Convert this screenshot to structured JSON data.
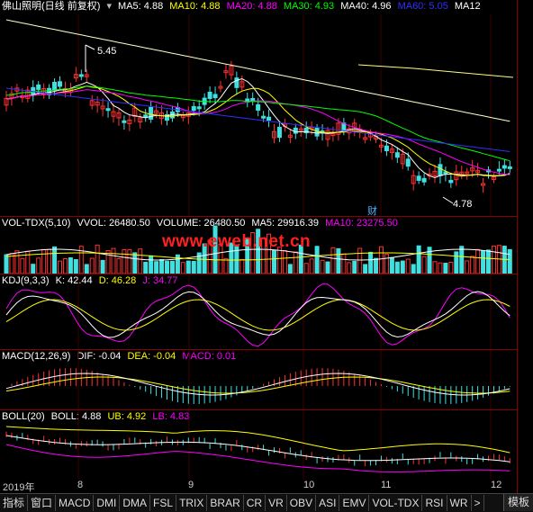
{
  "colors": {
    "ma5": "#ffffff",
    "ma10": "#ffff00",
    "ma20": "#ff00ff",
    "ma30": "#00ff00",
    "ma40": "#ffffff",
    "ma60": "#3030ff",
    "up": "#ff3030",
    "down": "#40e0e0",
    "watermark": "#ff2020"
  },
  "main": {
    "title": "佛山照明(日线 前复权)",
    "ma5": "MA5: 4.88",
    "ma10": "MA10: 4.88",
    "ma20": "MA20: 4.88",
    "ma30": "MA30: 4.93",
    "ma40": "MA40: 4.96",
    "ma60": "MA60: 5.05",
    "ma120": "MA12",
    "high_label": "5.45",
    "low_label": "4.78",
    "cai_label": "财"
  },
  "volume": {
    "name": "VOL-TDX(5,10)",
    "vvol": "VVOL: 26480.50",
    "volume": "VOLUME: 26480.50",
    "ma5": "MA5: 29916.39",
    "ma10": "MA10: 23275.50"
  },
  "watermark": "www.eweb.net.cn",
  "kdj": {
    "name": "KDJ(9,3,3)",
    "k": "K: 42.44",
    "d": "D: 46.28",
    "j": "J: 34.77"
  },
  "macd": {
    "name": "MACD(12,26,9)",
    "dif": "DIF: -0.04",
    "dea": "DEA: -0.04",
    "macd": "MACD: 0.01"
  },
  "boll": {
    "name": "BOLL(20)",
    "boll": "BOLL: 4.88",
    "ub": "UB: 4.92",
    "lb": "LB: 4.83"
  },
  "x_axis": {
    "year": "2019年",
    "m8": "8",
    "m9": "9",
    "m10": "10",
    "m11": "11",
    "m12": "12"
  },
  "tabs": [
    "指标",
    "窗口",
    "MACD",
    "DMI",
    "DMA",
    "FSL",
    "TRIX",
    "BRAR",
    "CR",
    "VR",
    "OBV",
    "ASI",
    "EMV",
    "VOL-TDX",
    "RSI",
    "WR",
    ">"
  ],
  "template_label": "模板"
}
